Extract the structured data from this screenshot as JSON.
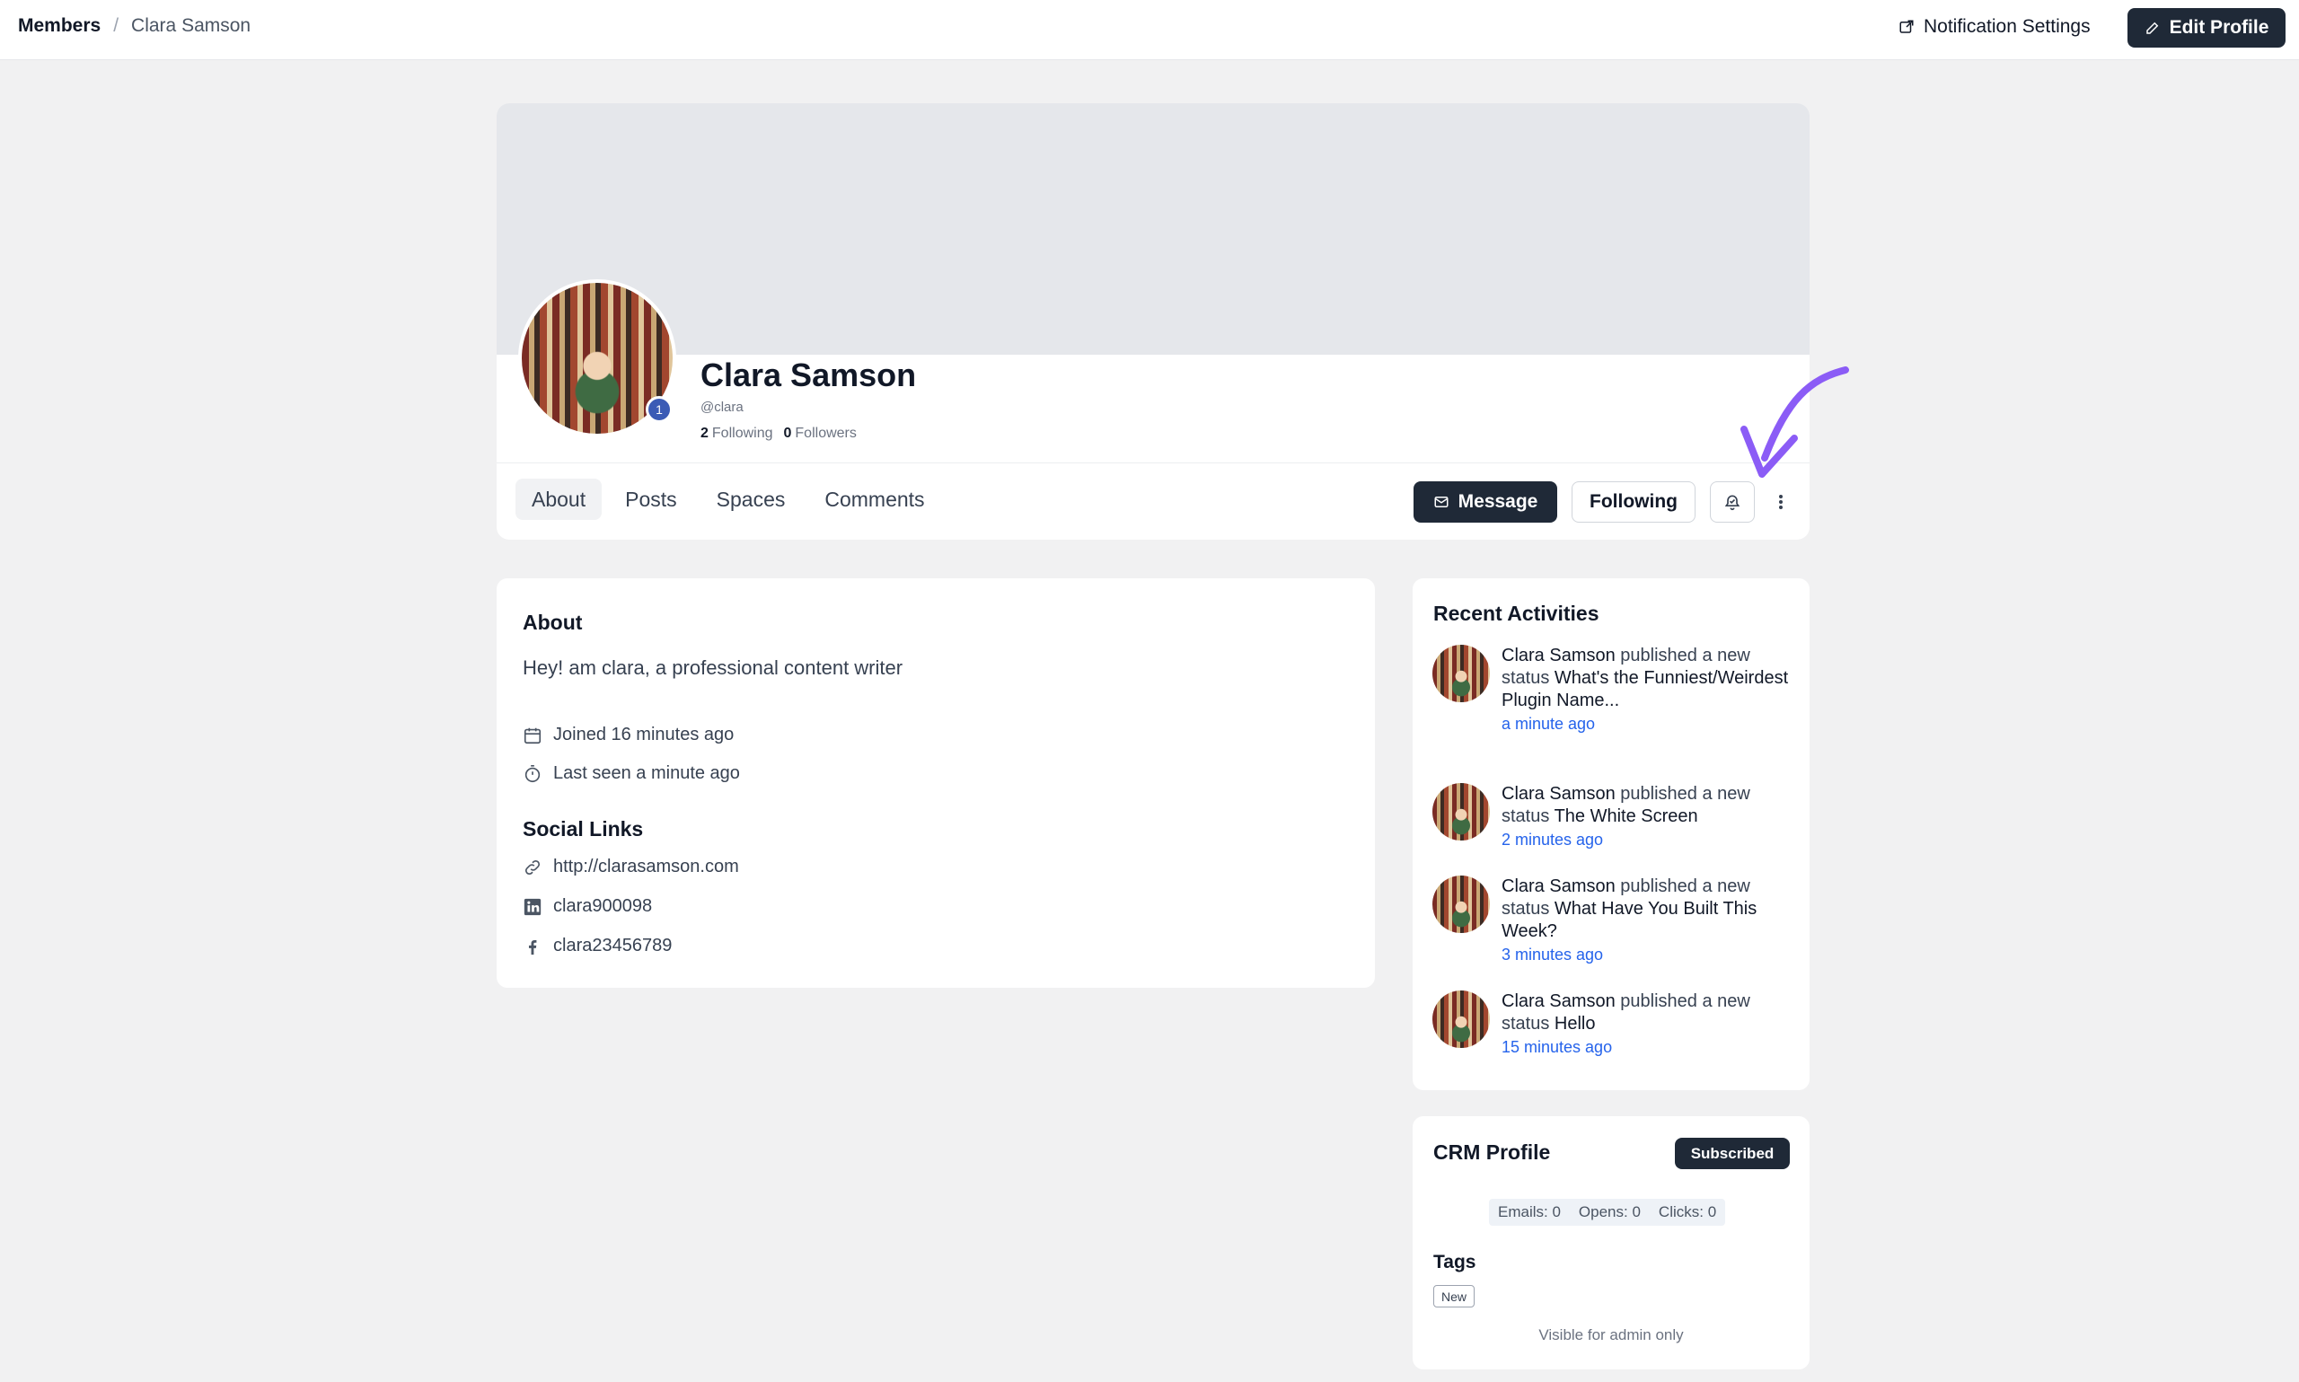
{
  "breadcrumb": {
    "root": "Members",
    "separator": "/",
    "current": "Clara Samson"
  },
  "header": {
    "notification_settings": "Notification Settings",
    "edit_profile": "Edit Profile"
  },
  "profile": {
    "name": "Clara Samson",
    "handle": "@clara",
    "badge": "1",
    "following_count": "2",
    "following_label": "Following",
    "followers_count": "0",
    "followers_label": "Followers"
  },
  "tabs": [
    {
      "label": "About",
      "active": true
    },
    {
      "label": "Posts",
      "active": false
    },
    {
      "label": "Spaces",
      "active": false
    },
    {
      "label": "Comments",
      "active": false
    }
  ],
  "actions": {
    "message": "Message",
    "following": "Following",
    "bell_icon": "bell-check-icon",
    "more_icon": "vertical-dots-icon"
  },
  "about": {
    "title": "About",
    "bio": "Hey! am clara, a professional content writer",
    "joined": "Joined 16 minutes ago",
    "last_seen": "Last seen a minute ago",
    "social_title": "Social Links",
    "social": [
      {
        "icon": "link-icon",
        "text": "http://clarasamson.com"
      },
      {
        "icon": "linkedin-icon",
        "text": "clara900098"
      },
      {
        "icon": "facebook-icon",
        "text": "clara23456789"
      }
    ]
  },
  "recent_activities": {
    "title": "Recent Activities",
    "items": [
      {
        "actor": "Clara Samson",
        "verb": "published a new status",
        "subject": "What's the Funniest/Weirdest Plugin Name...",
        "time": "a minute ago"
      },
      {
        "actor": "Clara Samson",
        "verb": "published a new status",
        "subject": "The White Screen",
        "time": "2 minutes ago"
      },
      {
        "actor": "Clara Samson",
        "verb": "published a new status",
        "subject": "What Have You Built This Week?",
        "time": "3 minutes ago"
      },
      {
        "actor": "Clara Samson",
        "verb": "published a new status",
        "subject": "Hello",
        "time": "15 minutes ago"
      }
    ]
  },
  "crm": {
    "title": "CRM Profile",
    "status": "Subscribed",
    "emails": "Emails: 0",
    "opens": "Opens: 0",
    "clicks": "Clicks: 0",
    "tags_title": "Tags",
    "tags": [
      "New"
    ],
    "admin_note": "Visible for admin only"
  },
  "colors": {
    "accent_dark": "#1f2937",
    "link_blue": "#2563eb",
    "badge_blue": "#3b5bb5",
    "annotation_arrow": "#8b5cf6"
  }
}
